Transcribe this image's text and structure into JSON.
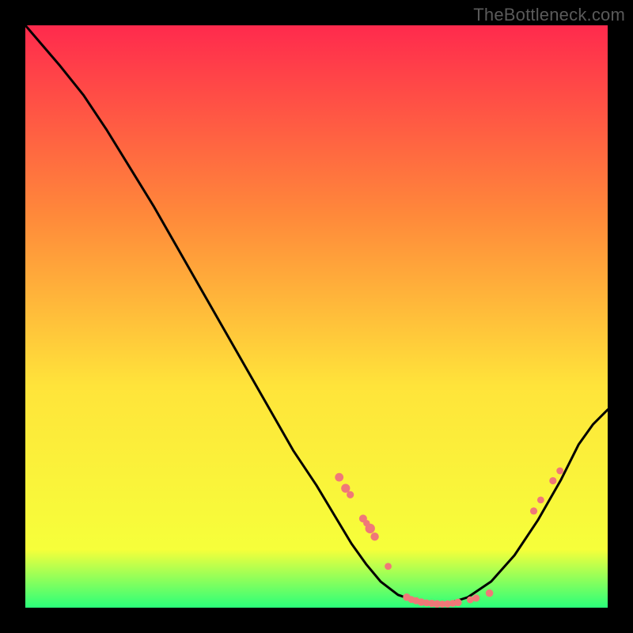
{
  "watermark": "TheBottleneck.com",
  "colors": {
    "gradient_top": "#ff2a4d",
    "gradient_upper_mid": "#ff8a3a",
    "gradient_mid": "#ffe43a",
    "gradient_lower": "#f6ff3a",
    "gradient_bottom": "#2aff7a",
    "curve": "#000000",
    "marker": "#f07878",
    "background": "#000000"
  },
  "chart_data": {
    "type": "line",
    "title": "",
    "xlabel": "",
    "ylabel": "",
    "xlim": [
      0,
      100
    ],
    "ylim": [
      0,
      100
    ],
    "curve": {
      "x": [
        0,
        3,
        6,
        10,
        14,
        18,
        22,
        26,
        30,
        34,
        38,
        42,
        46,
        50,
        53,
        56,
        58.5,
        61,
        64,
        68,
        72,
        76,
        80,
        84,
        88,
        92,
        95,
        97.5,
        100
      ],
      "y": [
        100,
        96.5,
        93,
        88,
        82,
        75.5,
        69,
        62,
        55,
        48,
        41,
        34,
        27,
        21,
        16,
        11,
        7.5,
        4.5,
        2.2,
        0.8,
        0.5,
        1.8,
        4.5,
        9,
        15,
        22,
        28,
        31.5,
        34
      ]
    },
    "markers": [
      {
        "x": 53.9,
        "y": 22.4,
        "r": 5.4
      },
      {
        "x": 55.0,
        "y": 20.5,
        "r": 5.6
      },
      {
        "x": 55.8,
        "y": 19.4,
        "r": 4.6
      },
      {
        "x": 58.0,
        "y": 15.3,
        "r": 5.0
      },
      {
        "x": 58.6,
        "y": 14.5,
        "r": 4.2
      },
      {
        "x": 59.2,
        "y": 13.6,
        "r": 6.2
      },
      {
        "x": 60.0,
        "y": 12.2,
        "r": 5.2
      },
      {
        "x": 62.3,
        "y": 7.1,
        "r": 4.4
      },
      {
        "x": 65.5,
        "y": 1.8,
        "r": 4.8
      },
      {
        "x": 66.3,
        "y": 1.4,
        "r": 4.4
      },
      {
        "x": 67.1,
        "y": 1.2,
        "r": 4.6
      },
      {
        "x": 68.0,
        "y": 0.95,
        "r": 4.8
      },
      {
        "x": 68.9,
        "y": 0.82,
        "r": 4.4
      },
      {
        "x": 69.8,
        "y": 0.73,
        "r": 4.6
      },
      {
        "x": 70.7,
        "y": 0.65,
        "r": 4.8
      },
      {
        "x": 71.6,
        "y": 0.62,
        "r": 4.4
      },
      {
        "x": 72.5,
        "y": 0.65,
        "r": 4.6
      },
      {
        "x": 73.4,
        "y": 0.75,
        "r": 4.4
      },
      {
        "x": 74.3,
        "y": 0.9,
        "r": 4.8
      },
      {
        "x": 76.4,
        "y": 1.35,
        "r": 4.4
      },
      {
        "x": 77.4,
        "y": 1.65,
        "r": 4.6
      },
      {
        "x": 79.7,
        "y": 2.5,
        "r": 4.8
      },
      {
        "x": 87.3,
        "y": 16.6,
        "r": 4.6
      },
      {
        "x": 88.5,
        "y": 18.5,
        "r": 4.4
      },
      {
        "x": 90.6,
        "y": 21.8,
        "r": 4.6
      },
      {
        "x": 91.8,
        "y": 23.5,
        "r": 4.4
      }
    ]
  }
}
